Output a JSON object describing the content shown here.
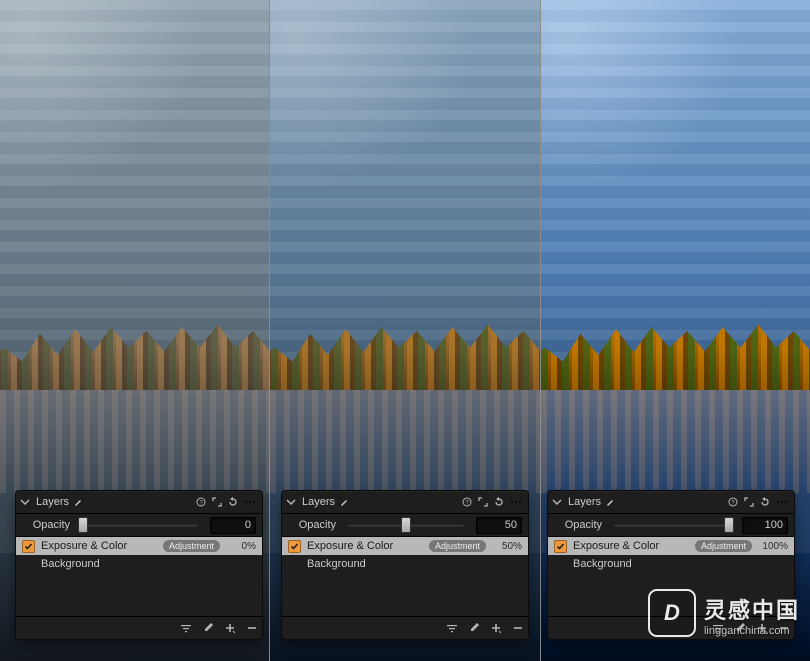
{
  "panels": [
    {
      "title": "Layers",
      "opacity_label": "Opacity",
      "opacity_value": "0",
      "opacity_pct": 0,
      "layers": [
        {
          "name": "Exposure & Color",
          "checked": true,
          "selected": true,
          "badge": "Adjustment",
          "pct": "0%"
        },
        {
          "name": "Background",
          "checked": false,
          "selected": false,
          "badge": "",
          "pct": ""
        }
      ]
    },
    {
      "title": "Layers",
      "opacity_label": "Opacity",
      "opacity_value": "50",
      "opacity_pct": 50,
      "layers": [
        {
          "name": "Exposure & Color",
          "checked": true,
          "selected": true,
          "badge": "Adjustment",
          "pct": "50%"
        },
        {
          "name": "Background",
          "checked": false,
          "selected": false,
          "badge": "",
          "pct": ""
        }
      ]
    },
    {
      "title": "Layers",
      "opacity_label": "Opacity",
      "opacity_value": "100",
      "opacity_pct": 100,
      "layers": [
        {
          "name": "Exposure & Color",
          "checked": true,
          "selected": true,
          "badge": "Adjustment",
          "pct": "100%"
        },
        {
          "name": "Background",
          "checked": false,
          "selected": false,
          "badge": "",
          "pct": ""
        }
      ]
    }
  ],
  "watermark": {
    "logo": "D",
    "main": "灵感中国",
    "sub": "lingganchina.com"
  },
  "slice_filters": [
    "saturate(0.6) brightness(1.02) hue-rotate(-3deg)",
    "saturate(1.05) contrast(1.05)",
    "saturate(1.55) contrast(1.12) brightness(1.03) hue-rotate(4deg)"
  ]
}
